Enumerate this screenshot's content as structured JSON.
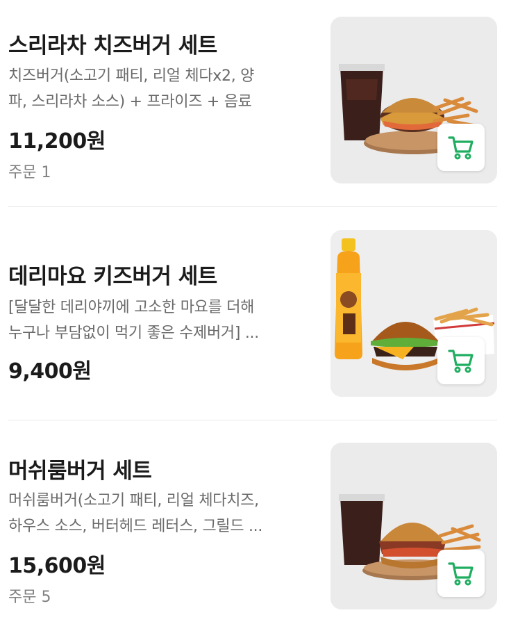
{
  "colors": {
    "accent": "#1fae60",
    "divider": "#e8e8e8"
  },
  "items": [
    {
      "name": "스리라차 치즈버거 세트",
      "desc_line1": "치즈버거(소고기 패티, 리얼 체다x2, 양",
      "desc_line2": "파, 스리라차 소스) + 프라이즈 + 음료",
      "price": "11,200원",
      "orders": "주문 1",
      "cart_icon": "cart-icon"
    },
    {
      "name": "데리마요 키즈버거 세트",
      "desc_line1": "[달달한 데리야끼에 고소한 마요를 더해",
      "desc_line2": "누구나 부담없이 먹기 좋은 수제버거] ...",
      "price": "9,400원",
      "cart_icon": "cart-icon"
    },
    {
      "name": "머쉬룸버거 세트",
      "desc_line1": "머쉬룸버거(소고기 패티, 리얼 체다치즈,",
      "desc_line2": "하우스 소스, 버터헤드 레터스, 그릴드 ...",
      "price": "15,600원",
      "orders": "주문 5",
      "cart_icon": "cart-icon"
    }
  ]
}
